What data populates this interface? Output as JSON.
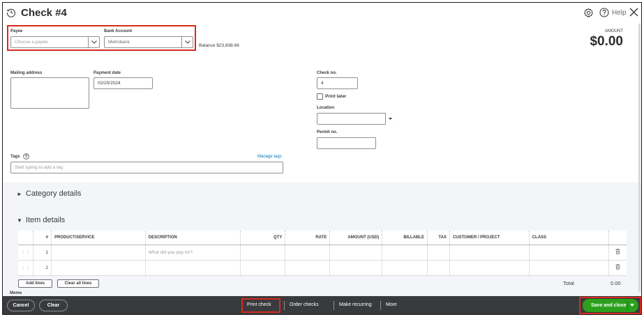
{
  "header": {
    "title": "Check #4",
    "help_label": "Help"
  },
  "payee": {
    "label": "Payee",
    "placeholder": "Choose a payee"
  },
  "bank_account": {
    "label": "Bank Account",
    "value": "Metrobank",
    "balance": "Balance $23,838.66"
  },
  "amount": {
    "label": "AMOUNT",
    "value": "$0.00"
  },
  "mailing_address": {
    "label": "Mailing address"
  },
  "payment_date": {
    "label": "Payment date",
    "value": "02/25/2024"
  },
  "check_no": {
    "label": "Check no.",
    "value": "4",
    "print_later_label": "Print later"
  },
  "location": {
    "label": "Location"
  },
  "permit_no": {
    "label": "Permit no."
  },
  "tags": {
    "label": "Tags",
    "manage_label": "Manage tags",
    "placeholder": "Start typing to add a tag"
  },
  "sections": {
    "category_details": "Category details",
    "item_details": "Item details"
  },
  "item_table": {
    "headers": [
      "#",
      "PRODUCT/SERVICE",
      "DESCRIPTION",
      "QTY",
      "RATE",
      "AMOUNT (USD)",
      "BILLABLE",
      "TAX",
      "CUSTOMER / PROJECT",
      "CLASS"
    ],
    "rows": [
      {
        "num": "1",
        "description_placeholder": "What did you pay for?"
      },
      {
        "num": "2",
        "description_placeholder": ""
      }
    ]
  },
  "table_buttons": {
    "add_lines": "Add lines",
    "clear_all_lines": "Clear all lines"
  },
  "total": {
    "label": "Total",
    "value": "0.00"
  },
  "memo": {
    "label": "Memo"
  },
  "footer": {
    "cancel": "Cancel",
    "clear": "Clear",
    "print_check": "Print check",
    "order_checks": "Order checks",
    "make_recurring": "Make recurring",
    "more": "More",
    "save_and_close": "Save and close"
  },
  "colors": {
    "accent_green": "#2ca01c",
    "highlight_red": "#d52b1e",
    "footer_bg": "#393a3d",
    "link_blue": "#0077c5"
  }
}
